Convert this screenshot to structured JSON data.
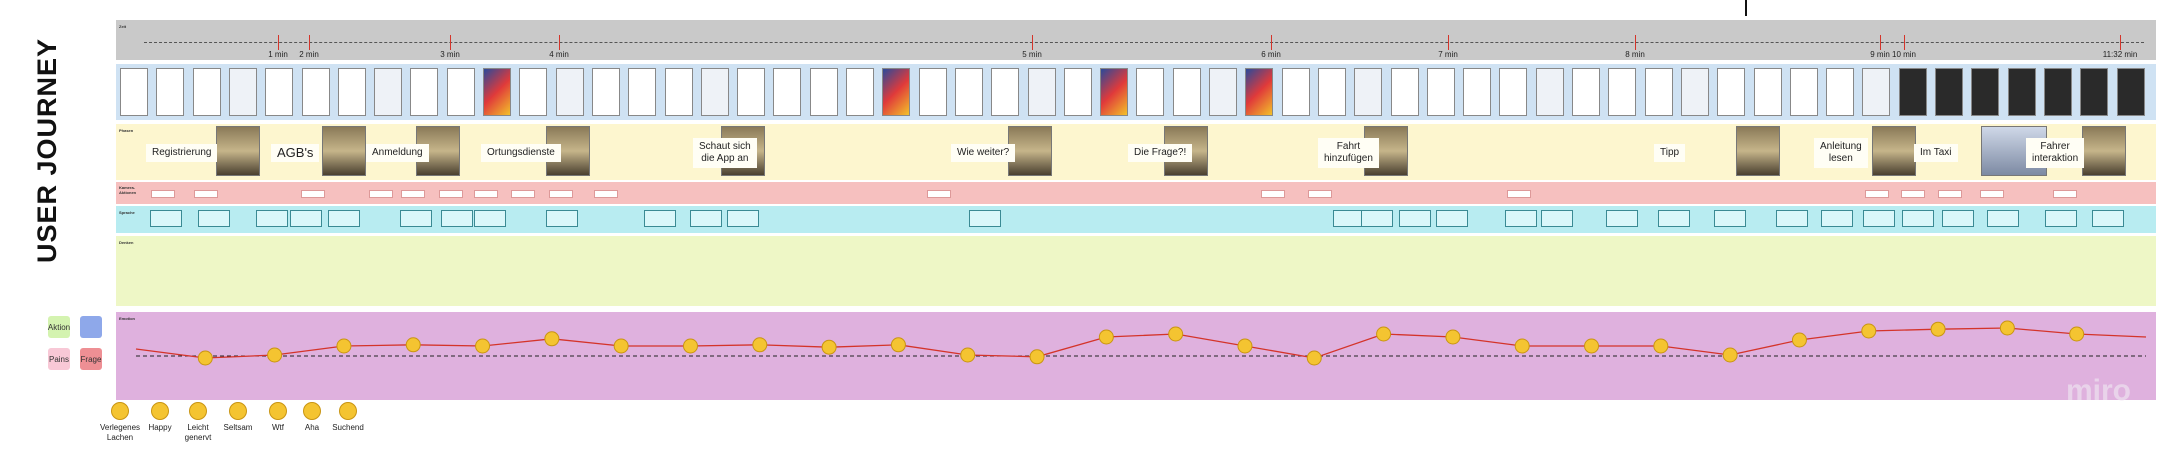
{
  "title": "USER JOURNEY",
  "rows": {
    "zeit": "Zeit",
    "screenshots": "",
    "phasen": "Phasen",
    "kamera": "Kamera-Aktionen",
    "sprache": "Sprache",
    "denken": "Denken",
    "emotion": "Emotion"
  },
  "timeline": {
    "ticks": [
      "1 min",
      "2 min",
      "3 min",
      "4 min",
      "5 min",
      "6 min",
      "7 min",
      "8 min",
      "9 min",
      "10 min",
      "11:32 min"
    ]
  },
  "phases": [
    "Registrierung",
    "AGB's",
    "Anmeldung",
    "Ortungsdienste",
    "Schaut sich\ndie App an",
    "Wie weiter?",
    "Die Frage?!",
    "Fahrt\nhinzufügen",
    "Tipp",
    "Anleitung\nlesen",
    "Im Taxi",
    "Fahrer\ninteraktion"
  ],
  "legend": {
    "aktion": "Aktion",
    "pains": "Pains",
    "frage": "Frage",
    "blue": ""
  },
  "emotions": [
    {
      "label": "Verlegenes\nLachen"
    },
    {
      "label": "Happy"
    },
    {
      "label": "Leicht\ngenervt"
    },
    {
      "label": "Seltsam"
    },
    {
      "label": "Wtf"
    },
    {
      "label": "Aha"
    },
    {
      "label": "Suchend"
    }
  ],
  "emotion_curve": [
    0.45,
    0.6,
    0.55,
    0.4,
    0.38,
    0.4,
    0.28,
    0.4,
    0.4,
    0.38,
    0.42,
    0.38,
    0.55,
    0.58,
    0.25,
    0.2,
    0.4,
    0.6,
    0.2,
    0.25,
    0.4,
    0.4,
    0.4,
    0.55,
    0.3,
    0.15,
    0.12,
    0.1,
    0.2,
    0.25
  ],
  "watermark": "miro"
}
